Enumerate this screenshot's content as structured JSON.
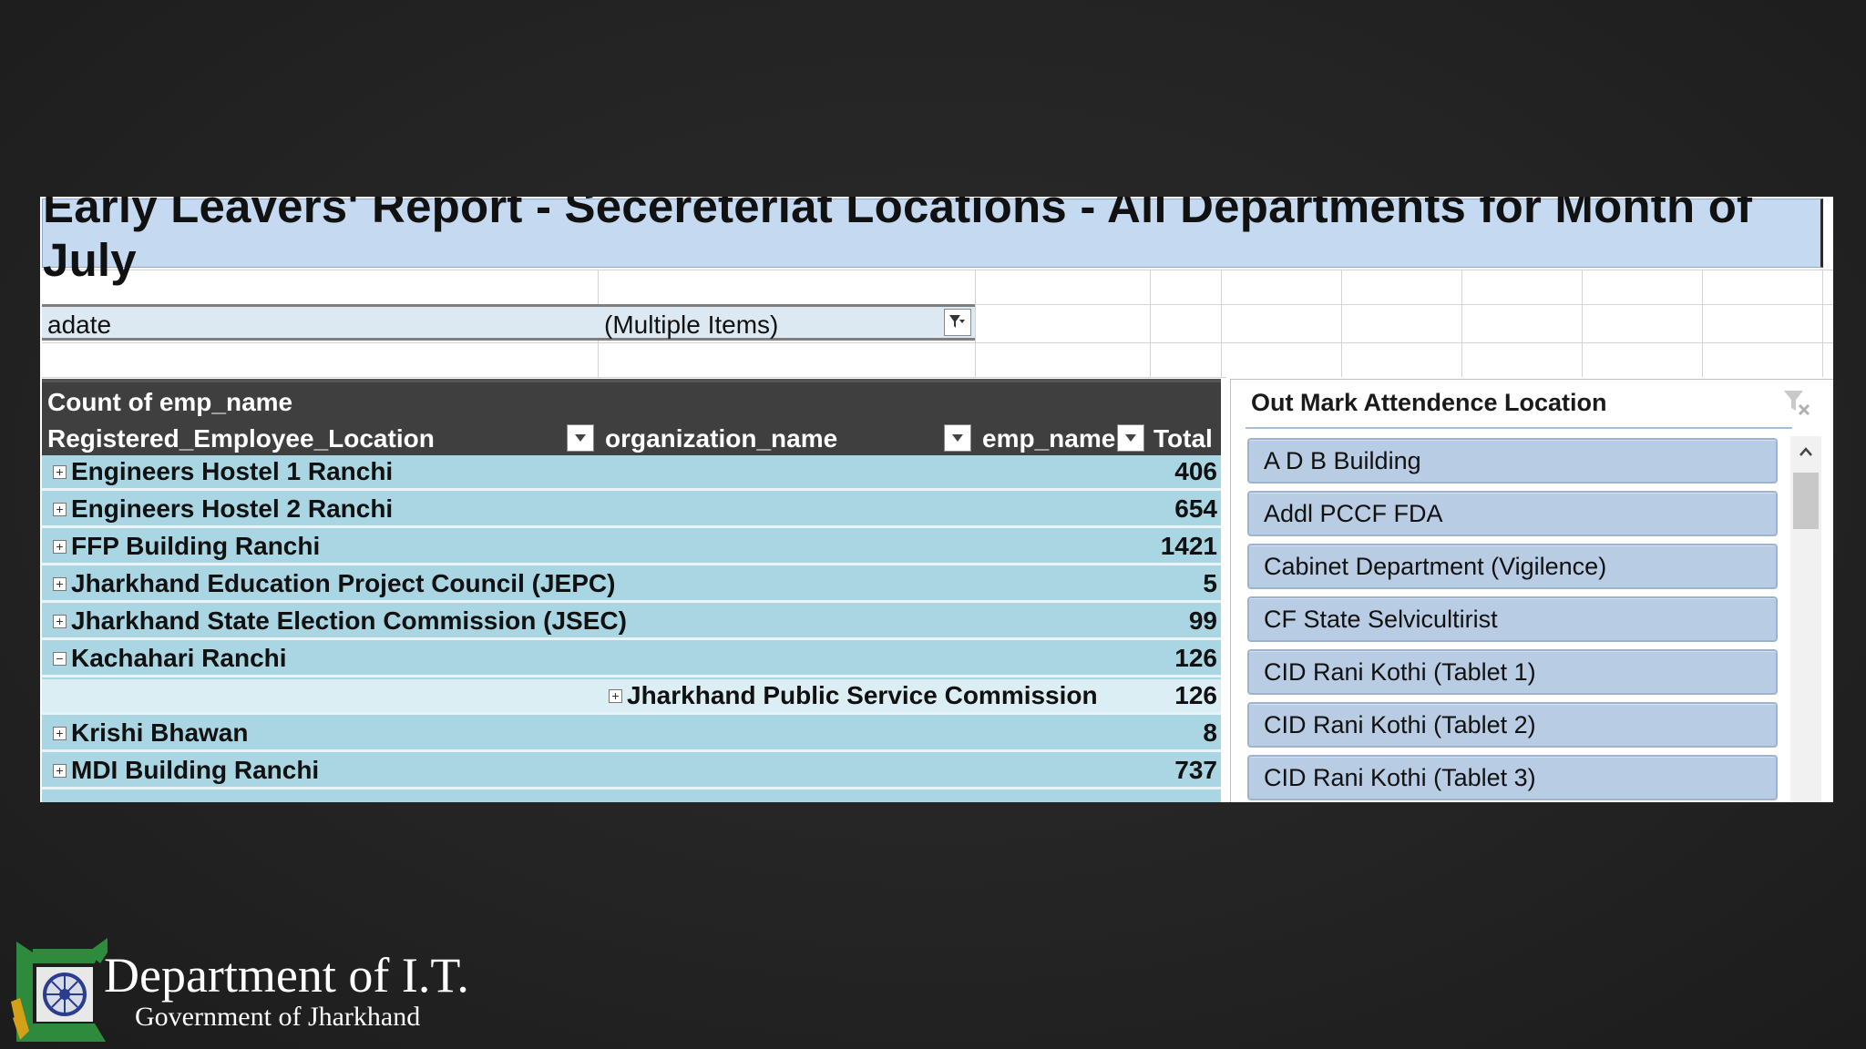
{
  "report": {
    "title": "Early Leavers' Report - Secereteriat Locations - All Departments for Month of July"
  },
  "filter": {
    "field": "adate",
    "value": "(Multiple Items)"
  },
  "pivot": {
    "value_field": "Count of emp_name",
    "columns": [
      "Registered_Employee_Location",
      "organization_name",
      "emp_name",
      "Total"
    ],
    "rows": [
      {
        "label": "Engineers Hostel 1 Ranchi",
        "total": "406",
        "expanded": false
      },
      {
        "label": "Engineers Hostel 2 Ranchi",
        "total": "654",
        "expanded": false
      },
      {
        "label": "FFP Building Ranchi",
        "total": "1421",
        "expanded": false
      },
      {
        "label": "Jharkhand Education Project Council (JEPC)",
        "total": "5",
        "expanded": false
      },
      {
        "label": "Jharkhand State Election Commission (JSEC)",
        "total": "99",
        "expanded": false
      },
      {
        "label": "Kachahari Ranchi",
        "total": "126",
        "expanded": true
      },
      {
        "label": "Jharkhand Public Service Commission",
        "total": "126",
        "sub": true
      },
      {
        "label": "Krishi Bhawan",
        "total": "8",
        "expanded": false
      },
      {
        "label": "MDI Building Ranchi",
        "total": "737",
        "expanded": false
      }
    ]
  },
  "slicer": {
    "title": "Out Mark Attendence Location",
    "items": [
      "A D B Building",
      "Addl PCCF FDA",
      "Cabinet Department (Vigilence)",
      "CF State Selvicultirist",
      "CID Rani Kothi (Tablet 1)",
      "CID Rani Kothi (Tablet 2)",
      "CID Rani Kothi (Tablet 3)"
    ]
  },
  "branding": {
    "department": "Department of I.T.",
    "government": "Government of Jharkhand"
  },
  "colors": {
    "title_bg": "#c5d9f1",
    "row_bg": "#a9d6e2",
    "slicer_item_bg": "#b8cce4",
    "header_bg": "#3f3f3f"
  }
}
